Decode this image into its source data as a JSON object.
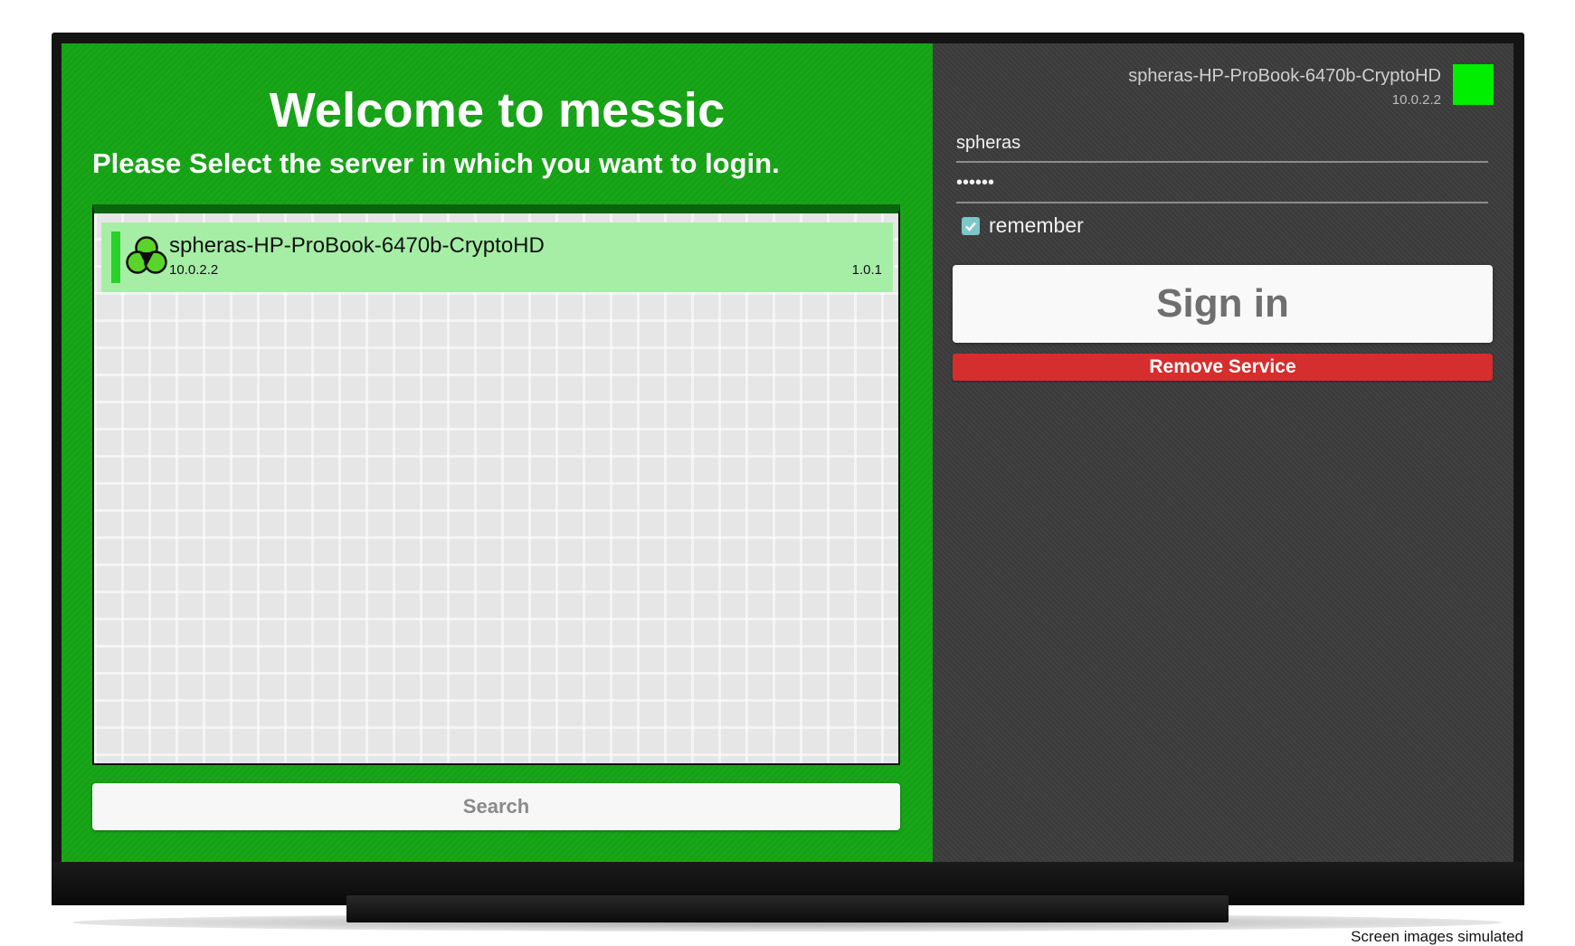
{
  "welcome": {
    "title": "Welcome to messic",
    "subtitle": "Please Select the server in which you want to login."
  },
  "servers": [
    {
      "name": "spheras-HP-ProBook-6470b-CryptoHD",
      "ip": "10.0.2.2",
      "version": "1.0.1",
      "selected": true
    }
  ],
  "search_label": "Search",
  "selected_server": {
    "name": "spheras-HP-ProBook-6470b-CryptoHD",
    "ip": "10.0.2.2",
    "status_color": "#00ee00"
  },
  "login": {
    "username": "spheras",
    "password": "••••••",
    "remember_label": "remember",
    "remember_checked": true,
    "signin_label": "Sign in",
    "remove_label": "Remove Service"
  },
  "disclaimer": "Screen images simulated",
  "colors": {
    "left_bg": "#14a214",
    "right_bg": "#3c3c3c",
    "selected_item": "#a6eea6",
    "remove": "#d42e2e"
  },
  "icons": {
    "server_logo": "messic-logo-icon",
    "checkbox": "checkbox-checked-icon"
  }
}
